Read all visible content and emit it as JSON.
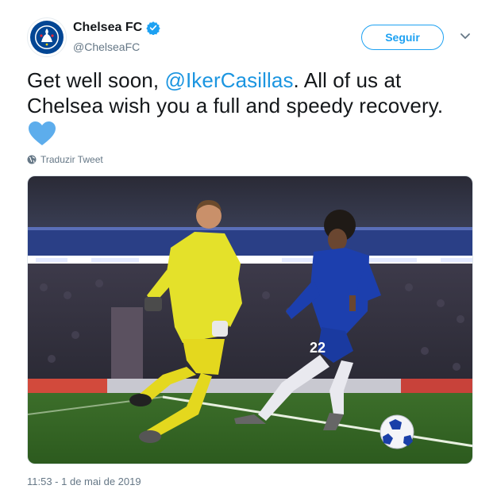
{
  "account": {
    "display_name": "Chelsea FC",
    "handle": "@ChelseaFC",
    "avatar_icon": "chelsea-crest-icon",
    "verified": true
  },
  "actions": {
    "follow_label": "Seguir",
    "menu_icon": "chevron-down-icon"
  },
  "tweet": {
    "text_before": "Get well soon, ",
    "mention": "@IkerCasillas",
    "text_after": ". All of us at Chelsea wish you a full and speedy recovery.",
    "emoji": "blue-heart-icon",
    "translate_label": "Traduzir Tweet",
    "timestamp": "11:53 - 1 de mai de 2019"
  },
  "media": {
    "description": "photo",
    "shirt_number": "22"
  },
  "colors": {
    "accent": "#1da1f2",
    "mention": "#1b95e0",
    "secondary_text": "#657786",
    "heart": "#5dadec"
  }
}
